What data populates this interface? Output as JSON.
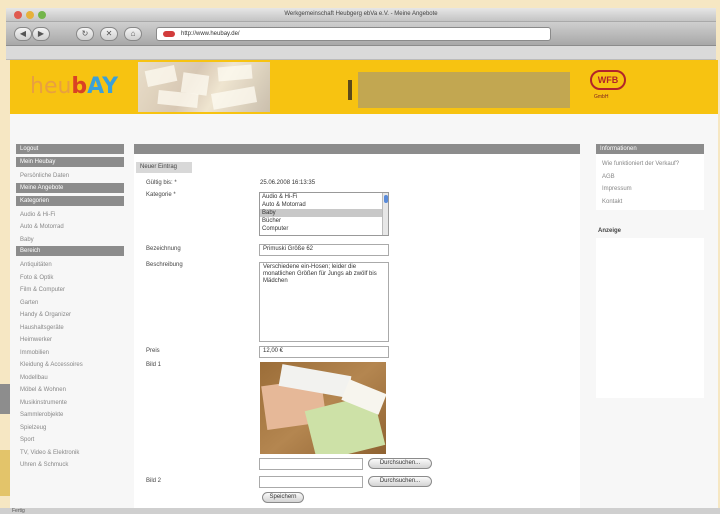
{
  "window": {
    "title": "Werkgemeinschaft Heubgerg ebVa e.V. - Meine Angebote"
  },
  "toolbar": {
    "back": "◀",
    "forward": "▶",
    "reload": "↻",
    "home": "⌂",
    "url": "http://www.heubay.de/"
  },
  "banner": {
    "logo_part1": "heu",
    "logo_part2": "b",
    "logo_part3": "AY",
    "brand_mark": "WFB",
    "brand_sub": "GmbH"
  },
  "left_nav": {
    "logout": "Logout",
    "mein_heubay": "Mein Heubay",
    "persoenliche_daten": "Persönliche Daten",
    "meine_angebote": "Meine Angebote",
    "kategorien": "Kategorien",
    "top_items": [
      "Audio & Hi-Fi",
      "Auto & Motorrad",
      "Baby"
    ],
    "bereich": "Bereich",
    "items": [
      "Antiquitäten",
      "Foto & Optik",
      "Film & Computer",
      "Garten",
      "Handy & Organizer",
      "Haushaltsgeräte",
      "Heimwerker",
      "Immobilien",
      "Kleidung & Accessoires",
      "Modellbau",
      "Möbel & Wohnen",
      "Musikinstrumente",
      "Sammlerobjekte",
      "Spielzeug",
      "Sport",
      "TV, Video & Elektronik",
      "Uhren & Schmuck"
    ]
  },
  "form": {
    "tab": "Neuer Eintrag",
    "labels": {
      "gueltig": "Gültig bis: *",
      "kategorie": "Kategorie *",
      "bezeichnung": "Bezeichnung",
      "beschreibung": "Beschreibung",
      "preis": "Preis",
      "bild1": "Bild 1",
      "bild2": "Bild 2"
    },
    "gueltig_value": "25.06.2008 16:13:35",
    "category_options": [
      "Audio & Hi-Fi",
      "Auto & Motorrad",
      "Baby",
      "Bücher",
      "Computer"
    ],
    "category_selected": "Baby",
    "bezeichnung_value": "Primuski Größe 62",
    "beschreibung_value": "Verschiedene ein-Hosen; leider die monatlichen Größen für Jungs ab zwölf bis Mädchen",
    "preis_value": "12,00 €",
    "browse_button": "Durchsuchen...",
    "submit_button": "Speichern"
  },
  "right_nav": {
    "header": "Informationen",
    "links": [
      "Wie funktioniert der Verkauf?",
      "AGB",
      "Impressum",
      "Kontakt"
    ],
    "ads_header": "Anzeige"
  },
  "status_bar": "Fertig",
  "colors": {
    "banner": "#f7c311",
    "header_gray": "#8c8c8c",
    "background": "#f6e7c3"
  }
}
